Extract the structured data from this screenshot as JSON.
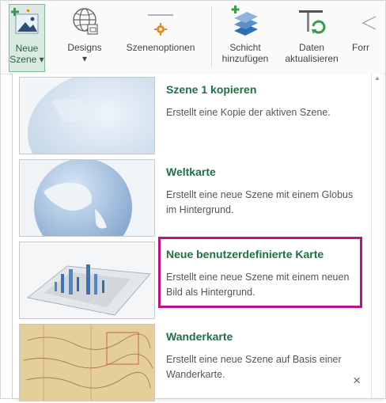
{
  "ribbon": {
    "buttons": [
      {
        "label": "Neue\nSzene ▾",
        "icon": "new-scene-icon"
      },
      {
        "label": "Designs\n▾",
        "icon": "globe-icon"
      },
      {
        "label": "Szenenoptionen",
        "icon": "scene-options-icon"
      },
      {
        "label": "Schicht\nhinzufügen",
        "icon": "add-layer-icon"
      },
      {
        "label": "Daten\naktualisieren",
        "icon": "refresh-data-icon"
      },
      {
        "label": "Forr",
        "icon": "format-icon"
      }
    ]
  },
  "menu": {
    "items": [
      {
        "title": "Szene 1 kopieren",
        "description": "Erstellt eine Kopie der aktiven Szene."
      },
      {
        "title": "Weltkarte",
        "description": "Erstellt eine neue Szene mit einem Globus im Hintergrund."
      },
      {
        "title": "Neue benutzerdefinierte Karte",
        "description": "Erstellt eine neue Szene mit einem neuen Bild als Hintergrund."
      },
      {
        "title": "Wanderkarte",
        "description": "Erstellt eine neue Szene auf Basis einer Wanderkarte."
      }
    ],
    "close_glyph": "×"
  },
  "colors": {
    "accent_green": "#1e7145",
    "highlight_magenta": "#c0118c",
    "active_button_bg": "#d9ebe1"
  }
}
